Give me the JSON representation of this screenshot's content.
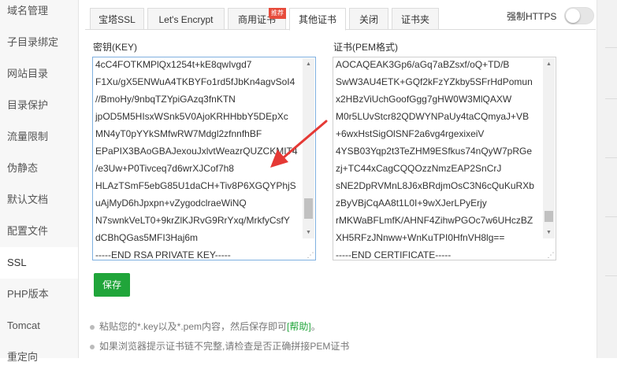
{
  "sidebar": {
    "items": [
      {
        "label": "域名管理"
      },
      {
        "label": "子目录绑定"
      },
      {
        "label": "网站目录"
      },
      {
        "label": "目录保护"
      },
      {
        "label": "流量限制"
      },
      {
        "label": "伪静态"
      },
      {
        "label": "默认文档"
      },
      {
        "label": "配置文件"
      },
      {
        "label": "SSL",
        "active": true
      },
      {
        "label": "PHP版本"
      },
      {
        "label": "Tomcat"
      },
      {
        "label": "重定向"
      }
    ]
  },
  "tabs": [
    {
      "label": "宝塔SSL"
    },
    {
      "label": "Let's Encrypt"
    },
    {
      "label": "商用证书",
      "badge": "推荐"
    },
    {
      "label": "其他证书",
      "active": true
    },
    {
      "label": "关闭"
    },
    {
      "label": "证书夹"
    }
  ],
  "force_https": {
    "label": "强制HTTPS",
    "enabled": false
  },
  "key_field": {
    "label": "密钥(KEY)",
    "lines": [
      "4cC4FOTKMPlQx1254t+kE8qwIvgd7",
      "F1Xu/gX5ENWuA4TKBYFo1rd5fJbKn4agvSoI4",
      "//BmoHy/9nbqTZYpiGAzq3fnKTN",
      "jpOD5M5HIsxWSnk5V0AjoKRHHbbY5DEpXc",
      "MN4yT0pYYkSMfwRW7Mdgl2zfnnfhBF",
      "EPaPIX3BAoGBAJexouJxlvtWeazrQUZCKMIT4",
      "/e3Uw+P0Tivceq7d6wrXJCof7h8",
      "HLAzTSmF5ebG85U1daCH+Tiv8P6XGQYPhjS",
      "uAjMyD6hJpxpn+vZygodclraeWiNQ",
      "N7swnkVeLT0+9krZlKJRvG9RrYxq/MrkfyCsfY",
      "dCBhQGas5MFI3Haj6m",
      "-----END RSA PRIVATE KEY-----"
    ],
    "scroll": {
      "thumb_start": 0.82,
      "thumb_size": 0.13
    }
  },
  "cert_field": {
    "label": "证书(PEM格式)",
    "lines": [
      "AOCAQEAK3Gp6/aGq7aBZsxf/oQ+TD/B",
      "SwW3AU4ETK+GQf2kFzYZkby5SFrHdPomun",
      "x2HBzViUchGoofGgg7gHW0W3MlQAXW",
      "M0r5LUvStcr82QDWYNPaUy4taCQmyaJ+VB",
      "+6wxHstSigOlSNF2a6vg4rgexixeiV",
      "4YSB03Yqp2t3TeZHM9ESfkus74nQyW7pRGe",
      "zj+TC44xCagCQQOzzNmzEAP2SnCrJ",
      "sNE2DpRVMnL8J6xBRdjmOsC3N6cQuKuRXb",
      "zByVBjCqAA8t1L0I+9wXJerLPyErjy",
      "rMKWaBFLmfK/AHNF4ZihwPGOc7w6UHczBZ",
      "XH5RFzJNnww+WnKuTPI0HfnVH8lg==",
      "-----END CERTIFICATE-----"
    ],
    "scroll": {
      "thumb_start": 0.9,
      "thumb_size": 0.07
    }
  },
  "save_button": {
    "label": "保存"
  },
  "notes": {
    "note1": "粘贴您的*.key以及*.pem内容，然后保存即可",
    "help": "[帮助]",
    "note1_end": "。",
    "note2": "如果浏览器提示证书链不完整,请检查是否正确拼接PEM证书"
  },
  "colors": {
    "accent": "#20a53a",
    "annotation_arrow": "#e53935",
    "badge": "#e74c3c",
    "focus_border": "#7fb0e0"
  },
  "icons": [
    "red-arrow-annotation-icon",
    "resize-grip-icon",
    "scroll-up-icon",
    "scroll-down-icon"
  ]
}
